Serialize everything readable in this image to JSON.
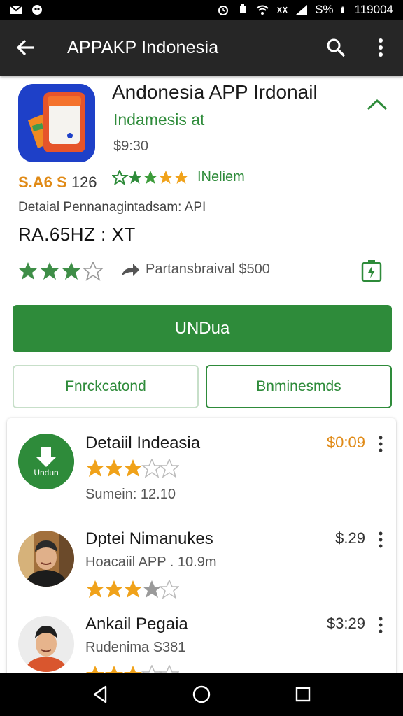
{
  "status_bar": {
    "battery_text": "S%",
    "time": "119004",
    "icons": [
      "gmail-icon",
      "chat-icon",
      "alarm-icon",
      "notification-icon",
      "wifi-icon",
      "data-icon",
      "signal-icon",
      "battery-icon"
    ]
  },
  "app_bar": {
    "title": "APPAKP Indonesia",
    "icons": [
      "back-arrow-icon",
      "search-icon",
      "more-vert-icon"
    ]
  },
  "app": {
    "name": "Andonesia APP Irdonail",
    "developer": "Indamesis at",
    "price": "$9:30",
    "rating_count_a": "S.A6 S",
    "rating_count_b": "126",
    "green_stars_label": "INeliem",
    "details_line": "Detaial Pennanagintadsam: API",
    "code_line": "RA.65HZ : XT",
    "share_label": "Partansbraival $500",
    "rating": 3.5
  },
  "buttons": {
    "install": "UNDua",
    "secondary_left": "Fnrckcatond",
    "secondary_right": "Bnminesmds"
  },
  "list": [
    {
      "title": "Detaiil Indeasia",
      "price": "$0:09",
      "price_color": "#e08a16",
      "subtitle": "Sumein: 12.10",
      "rating": 3,
      "avatar_label": "Undun",
      "avatar_type": "download-icon"
    },
    {
      "title": "Dptei Nimanukes",
      "price": "$.29",
      "price_color": "#333333",
      "subtitle": "Hoacaiil APP . 10.9m",
      "rating": 3,
      "avatar_type": "person-photo"
    },
    {
      "title": "Ankail Pegaia",
      "price": "$3:29",
      "price_color": "#333333",
      "subtitle": "Rudenima S381",
      "rating": 3,
      "avatar_type": "person-photo"
    }
  ],
  "colors": {
    "accent_green": "#2e8b3a",
    "star_orange": "#f0a21a",
    "app_bar": "#262626",
    "icon_blue": "#1e40c8"
  }
}
